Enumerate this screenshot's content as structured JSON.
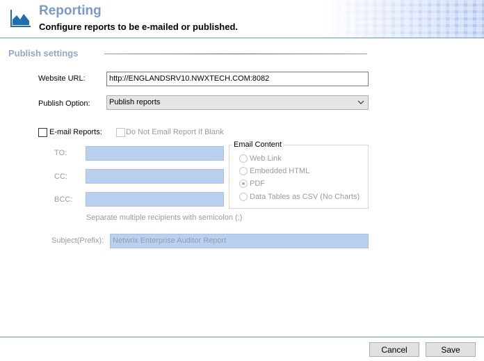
{
  "header": {
    "title": "Reporting",
    "subtitle": "Configure reports to be e-mailed or published.",
    "logo_icon": "chart-area-icon",
    "accent": "#7a99c9"
  },
  "publish": {
    "section_title": "Publish settings",
    "website_url_label": "Website URL:",
    "website_url_value": "http://ENGLANDSRV10.NWXTECH.COM:8082",
    "publish_option_label": "Publish Option:",
    "publish_option_value": "Publish reports"
  },
  "email": {
    "email_reports_label": "E-mail Reports:",
    "email_reports_checked": false,
    "do_not_email_blank_label": "Do Not Email Report If Blank",
    "do_not_email_blank_checked": false,
    "to_label": "TO:",
    "cc_label": "CC:",
    "bcc_label": "BCC:",
    "to_value": "",
    "cc_value": "",
    "bcc_value": "",
    "separate_hint": "Separate multiple recipients with semicolon (;)",
    "subject_label": "Subject(Prefix):",
    "subject_value": "Netwrix Enterprise Auditor Report",
    "content_group_title": "Email Content",
    "content_options": [
      "Web Link",
      "Embedded HTML",
      "PDF",
      "Data Tables as CSV (No Charts)"
    ],
    "content_selected": "PDF"
  },
  "footer": {
    "cancel_label": "Cancel",
    "save_label": "Save"
  }
}
